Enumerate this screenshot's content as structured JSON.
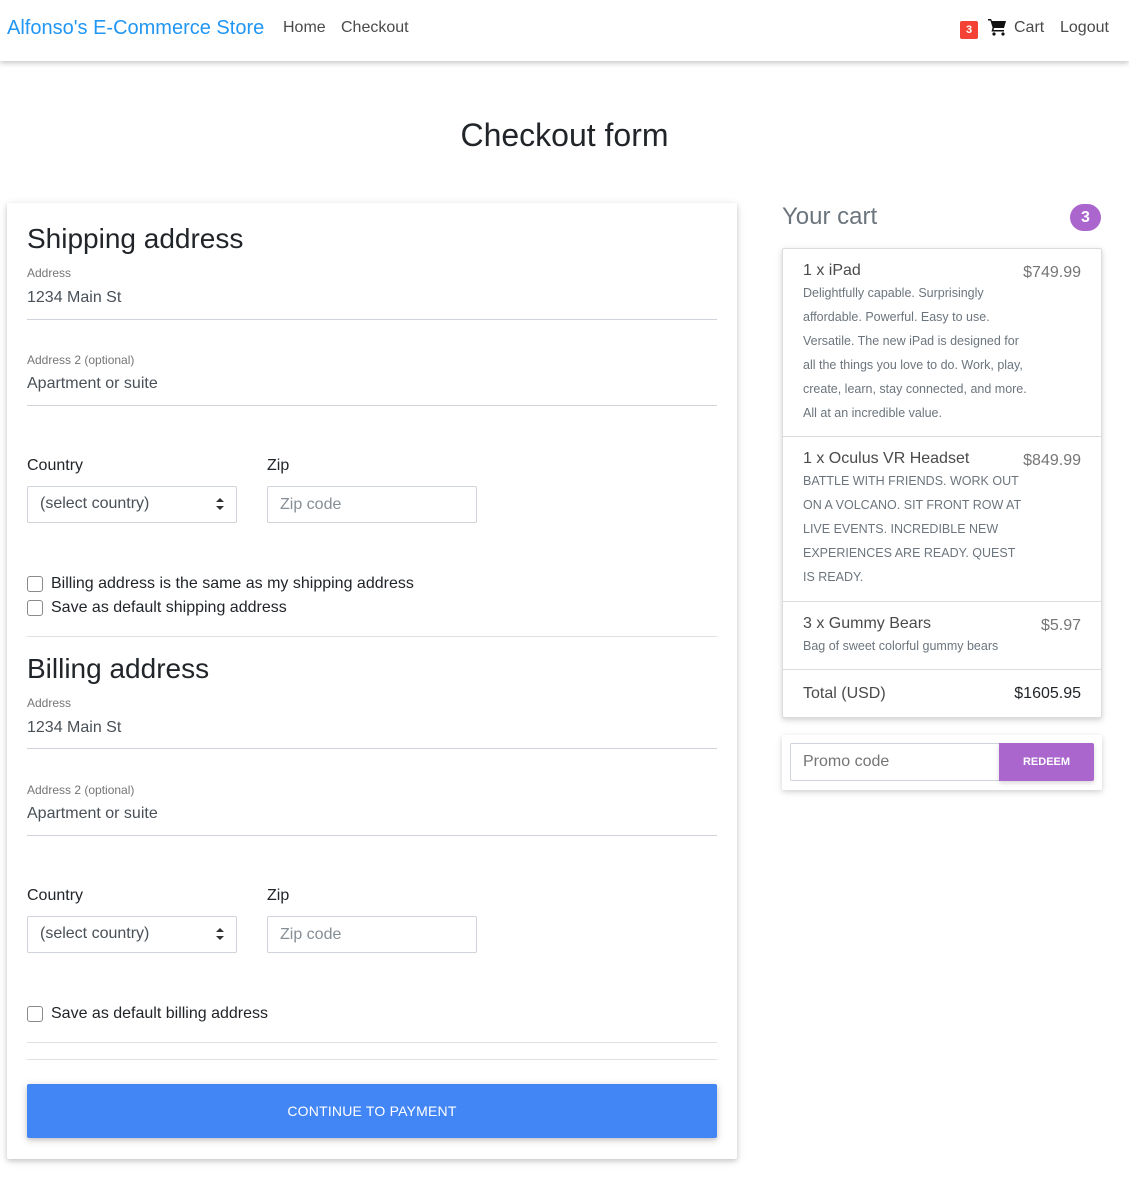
{
  "navbar": {
    "brand": "Alfonso's E-Commerce Store",
    "links": [
      "Home",
      "Checkout"
    ],
    "cart_badge": "3",
    "cart_label": "Cart",
    "logout_label": "Logout",
    "cart_icon": "shopping-cart-icon"
  },
  "page_title": "Checkout form",
  "shipping": {
    "title": "Shipping address",
    "address_label": "Address",
    "address_value": "1234 Main St",
    "address2_label": "Address 2 (optional)",
    "address2_value": "Apartment or suite",
    "country_label": "Country",
    "country_value": "(select country)",
    "zip_label": "Zip",
    "zip_placeholder": "Zip code",
    "checkbox_same": "Billing address is the same as my shipping address",
    "checkbox_default": "Save as default shipping address"
  },
  "billing": {
    "title": "Billing address",
    "address_label": "Address",
    "address_value": "1234 Main St",
    "address2_label": "Address 2 (optional)",
    "address2_value": "Apartment or suite",
    "country_label": "Country",
    "country_value": "(select country)",
    "zip_label": "Zip",
    "zip_placeholder": "Zip code",
    "checkbox_default": "Save as default billing address"
  },
  "continue_button": "CONTINUE TO PAYMENT",
  "cart": {
    "heading": "Your cart",
    "count": "3",
    "items": [
      {
        "name": "1 x iPad",
        "price": "$749.99",
        "desc": "Delightfully capable. Surprisingly affordable. Powerful. Easy to use. Versatile. The new iPad is designed for all the things you love to do. Work, play, create, learn, stay connected, and more. All at an incredible value."
      },
      {
        "name": "1 x Oculus VR Headset",
        "price": "$849.99",
        "desc": "BATTLE WITH FRIENDS. WORK OUT ON A VOLCANO. SIT FRONT ROW AT LIVE EVENTS. INCREDIBLE NEW EXPERIENCES ARE READY. QUEST IS READY."
      },
      {
        "name": "3 x Gummy Bears",
        "price": "$5.97",
        "desc": "Bag of sweet colorful gummy bears"
      }
    ],
    "total_label": "Total (USD)",
    "total_value": "$1605.95"
  },
  "promo": {
    "placeholder": "Promo code",
    "button": "REDEEM"
  },
  "colors": {
    "brand": "#2196f3",
    "primary": "#4285f4",
    "secondary": "#aa66cc",
    "danger": "#f44336"
  }
}
